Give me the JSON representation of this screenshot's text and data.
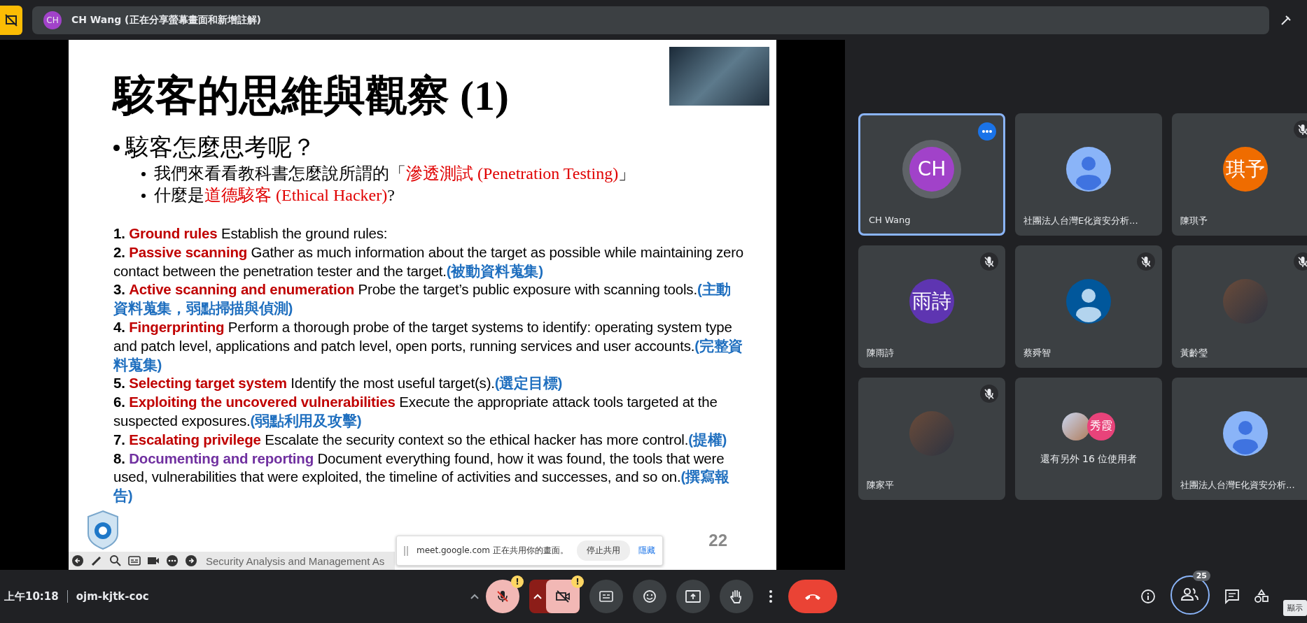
{
  "top_bar": {
    "presenter_initials": "CH",
    "presenter_text": "CH Wang (正在分享螢幕畫面和新增註解)"
  },
  "slide": {
    "title": "駭客的思維與觀察 (1)",
    "bullet": "駭客怎麼思考呢？",
    "sub_bullets": [
      {
        "before": "我們來看看教科書怎麼說所謂的「",
        "highlight": "滲透測試 (Penetration Testing)",
        "after": "」"
      },
      {
        "before": "什麼是",
        "highlight": "道德駭客 (Ethical Hacker)",
        "after": "?"
      }
    ],
    "steps": [
      {
        "number": "1.",
        "term": "Ground rules",
        "color": "#c00000",
        "text": "Establish the ground rules:"
      },
      {
        "number": "2.",
        "term": "Passive scanning",
        "color": "#c00000",
        "text": "Gather as much information about the target as possible while maintaining zero contact between the penetration tester and the target.",
        "note": "(被動資料蒐集)"
      },
      {
        "number": "3.",
        "term": "Active scanning and enumeration",
        "color": "#c00000",
        "text": "Probe the target’s public exposure with scanning tools.",
        "note": "(主動資料蒐集，弱點掃描與偵測)"
      },
      {
        "number": "4.",
        "term": "Fingerprinting",
        "color": "#c00000",
        "text": "Perform a thorough probe of the target systems to identify: operating system type and patch level, applications and patch level, open ports, running services and user accounts.",
        "note": "(完整資料蒐集)"
      },
      {
        "number": "5.",
        "term": "Selecting target system",
        "color": "#c00000",
        "text": "Identify the most useful target(s).",
        "note": "(選定目標)"
      },
      {
        "number": "6.",
        "term": "Exploiting the uncovered vulnerabilities",
        "color": "#c00000",
        "text": "Execute the appropriate attack tools targeted at the suspected exposures.",
        "note": "(弱點利用及攻擊)"
      },
      {
        "number": "7.",
        "term": "Escalating privilege",
        "color": "#c00000",
        "text": "Escalate the security context so the ethical hacker has more control.",
        "note": "(提權)"
      },
      {
        "number": "8.",
        "term": "Documenting and reporting",
        "color": "#7030a0",
        "text": "Document everything found, how it was found, the tools that were used, vulnerabilities that were exploited, the timeline of activities and successes, and so on.",
        "note": "(撰寫報告)"
      }
    ],
    "footer": "Security Analysis and Management As",
    "page_number": "22"
  },
  "share_banner": {
    "text": "meet.google.com 正在共用你的畫面。",
    "stop": "停止共用",
    "hide": "隱藏"
  },
  "tiles": [
    {
      "kind": "person",
      "name": "CH Wang",
      "focused": true,
      "muted": false,
      "avatar": {
        "kind": "initials",
        "text": "CH",
        "color": "#a142c9"
      }
    },
    {
      "kind": "person",
      "name": "社團法人台灣E化資安分析...",
      "focused": false,
      "muted": false,
      "avatar": {
        "kind": "silhouette",
        "color": "#8ab4f8"
      }
    },
    {
      "kind": "person",
      "name": "陳琪予",
      "focused": false,
      "muted": true,
      "avatar": {
        "kind": "initials",
        "text": "琪予",
        "color": "#ef6c00"
      }
    },
    {
      "kind": "person",
      "name": "陳雨詩",
      "focused": false,
      "muted": true,
      "avatar": {
        "kind": "initials",
        "text": "雨詩",
        "color": "#5e35b1"
      }
    },
    {
      "kind": "person",
      "name": "蔡舜智",
      "focused": false,
      "muted": true,
      "avatar": {
        "kind": "silhouette",
        "color": "#01579b"
      }
    },
    {
      "kind": "person",
      "name": "黃齡瑩",
      "focused": false,
      "muted": true,
      "avatar": {
        "kind": "photo"
      }
    },
    {
      "kind": "person",
      "name": "陳家平",
      "focused": false,
      "muted": true,
      "avatar": {
        "kind": "photo"
      }
    },
    {
      "kind": "others",
      "name": "還有另外 16 位使用者",
      "avatars": [
        {
          "kind": "photo"
        },
        {
          "kind": "initials",
          "text": "秀霞",
          "color": "#e8437a"
        }
      ]
    },
    {
      "kind": "person",
      "name": "社團法人台灣E化資安分析...",
      "focused": false,
      "muted": false,
      "avatar": {
        "kind": "silhouette",
        "color": "#8ab4f8"
      }
    }
  ],
  "bottom_bar": {
    "time": "上午10:18",
    "meeting_code": "ojm-kjtk-coc",
    "mic_muted": true,
    "mic_warning": "!",
    "camera_off": true,
    "camera_warning": "!",
    "participant_count": "25",
    "tooltip": "顯示"
  }
}
